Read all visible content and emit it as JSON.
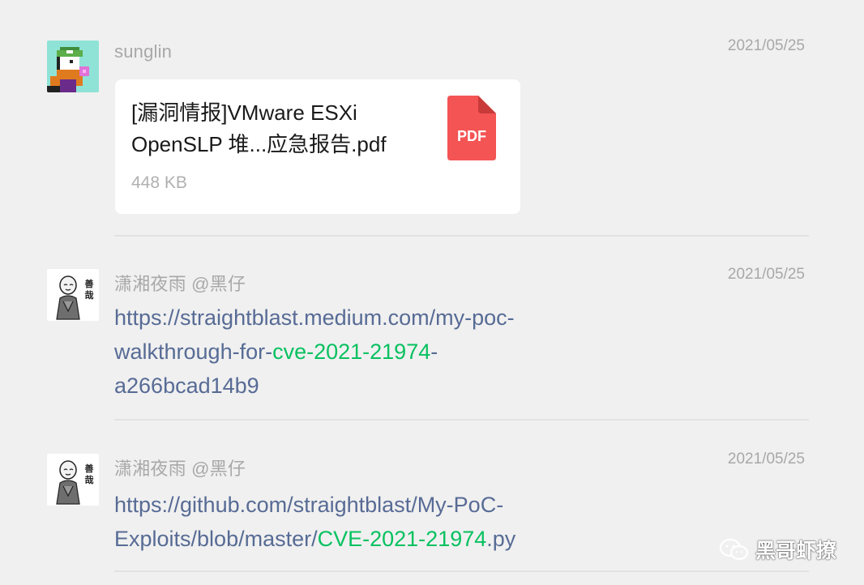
{
  "messages": [
    {
      "sender": "sunglin",
      "time": "2021/05/25",
      "file": {
        "name_line1": "[漏洞情报]VMware ESXi",
        "name_line2": "OpenSLP 堆...应急报告.pdf",
        "size": "448 KB",
        "icon_label": "PDF"
      }
    },
    {
      "sender": "潇湘夜雨 @黑仔",
      "time": "2021/05/25",
      "link": {
        "line1": "https://straightblast.medium.com/my-poc-",
        "line2_pre": "walkthrough-for-",
        "line2_hl": "cve-2021-21974",
        "line2_post": "-",
        "line3": "a266bcad14b9"
      }
    },
    {
      "sender": "潇湘夜雨 @黑仔",
      "time": "2021/05/25",
      "link": {
        "line1": "https://github.com/straightblast/My-PoC-",
        "line2_pre": "Exploits/blob/master/",
        "line2_hl": "CVE-2021-21974",
        "line2_post": ".py"
      }
    }
  ],
  "avatar_text": "善哉",
  "watermark": "黑哥虾撩",
  "colors": {
    "background": "#f0f0f0",
    "link": "#576b95",
    "highlight": "#07c160",
    "pdf": "#f45454"
  }
}
